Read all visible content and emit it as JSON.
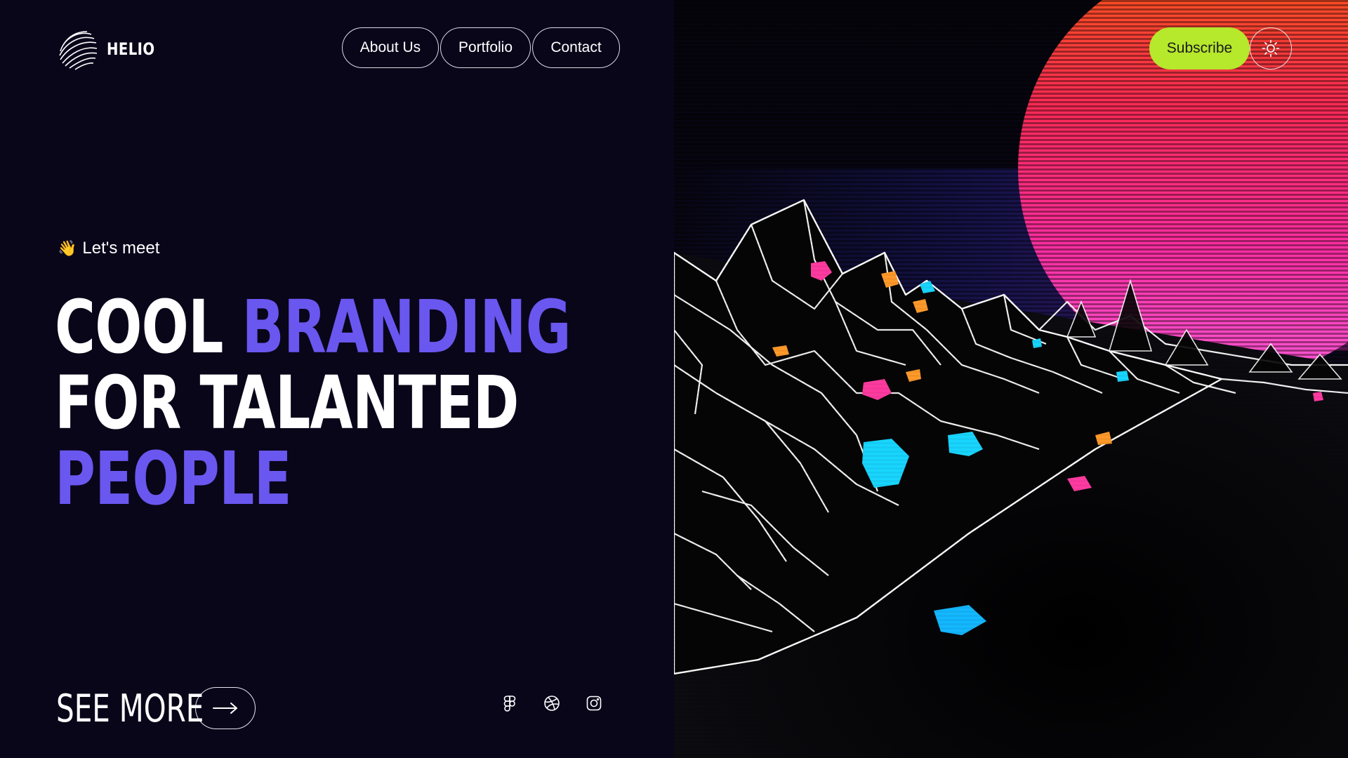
{
  "brand": {
    "name": "HELIO",
    "logo_icon": "wavy-sphere-logo"
  },
  "nav": {
    "items": [
      {
        "label": "About Us"
      },
      {
        "label": "Portfolio"
      },
      {
        "label": "Contact"
      }
    ]
  },
  "header_actions": {
    "subscribe_label": "Subscribe",
    "theme_icon": "sun-icon"
  },
  "hero": {
    "eyebrow_emoji": "👋",
    "eyebrow_text": "Let's meet",
    "line1_word1": "COOL",
    "line1_word2": "BRANDING",
    "line2": "FOR TALANTED",
    "line3": "PEOPLE"
  },
  "cta": {
    "see_more_label": "SEE MORE",
    "arrow_icon": "arrow-right-icon"
  },
  "socials": [
    {
      "icon": "figma-icon"
    },
    {
      "icon": "dribbble-icon"
    },
    {
      "icon": "instagram-icon"
    }
  ],
  "colors": {
    "background": "#09061a",
    "accent": "#6a57ef",
    "subscribe": "#b6e82c",
    "text": "#ffffff"
  }
}
